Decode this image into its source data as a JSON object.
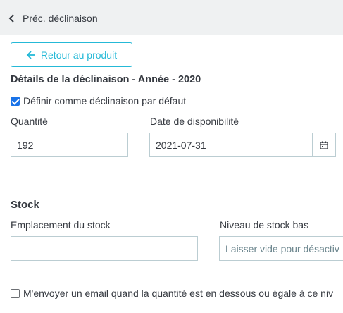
{
  "header": {
    "prev_label": "Préc. déclinaison"
  },
  "back_button": {
    "label": "Retour au produit"
  },
  "details": {
    "title": "Détails de la déclinaison - Année - 2020",
    "default_checkbox_label": "Définir comme déclinaison par défaut",
    "default_checked": true
  },
  "quantity": {
    "label": "Quantité",
    "value": "192"
  },
  "availability": {
    "label": "Date de disponibilité",
    "value": "2021-07-31",
    "icon": "calendar-icon"
  },
  "stock": {
    "title": "Stock",
    "location_label": "Emplacement du stock",
    "location_value": "",
    "low_stock_label": "Niveau de stock bas",
    "low_stock_placeholder": "Laisser vide pour désactiv",
    "email_checkbox_label": "M'envoyer un email quand la quantité est en dessous ou égale à ce niv",
    "email_checked": false
  },
  "colors": {
    "accent": "#25b9d7",
    "text": "#363a41",
    "border": "#bbcdd2",
    "topbar_bg": "#eff1f2"
  }
}
